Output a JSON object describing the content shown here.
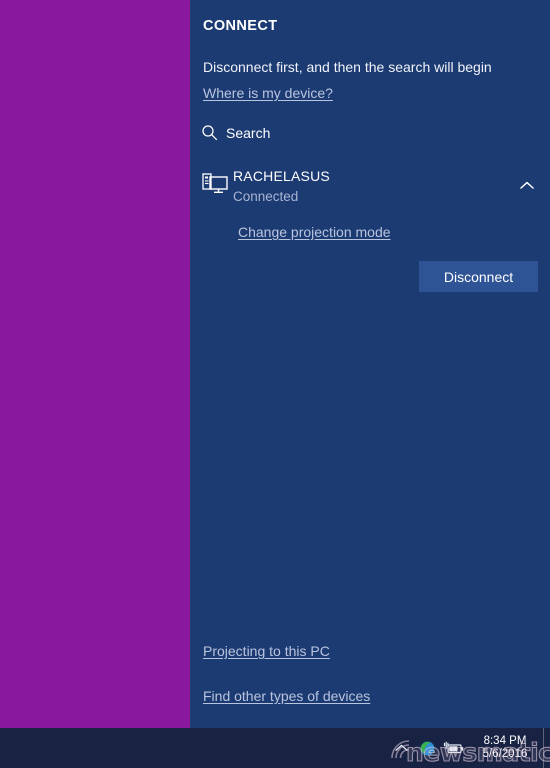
{
  "desktop": {
    "background_color": "#8A189F"
  },
  "panel": {
    "name": "connect-flyout",
    "background_color": "#1D3B73",
    "title": "CONNECT",
    "message": "Disconnect first, and then the search will begin",
    "where_is_my_device_link": "Where is my device?",
    "search": {
      "icon": "search-icon",
      "label": "Search"
    },
    "device": {
      "icon": "pc-and-monitor-icon",
      "name": "RACHELASUS",
      "status": "Connected",
      "status_color": "#A8B4D2",
      "collapse_icon": "chevron-up-icon",
      "change_projection_mode_link": "Change projection mode",
      "disconnect_button": "Disconnect",
      "disconnect_button_color": "#2F5496"
    },
    "footer_links": [
      "Projecting to this PC",
      "Find other types of devices"
    ],
    "link_color": "#B9C4DE"
  },
  "taskbar": {
    "background_color": "#182344",
    "show_hidden_icons": "chevron-up-icon",
    "tray_icons": [
      {
        "name": "network-globe-icon"
      },
      {
        "name": "battery-charging-icon"
      }
    ],
    "clock": {
      "time": "8:34 PM",
      "date": "5/6/2016"
    },
    "show_desktop_label": ""
  },
  "watermark": {
    "text": "newsmatic"
  }
}
